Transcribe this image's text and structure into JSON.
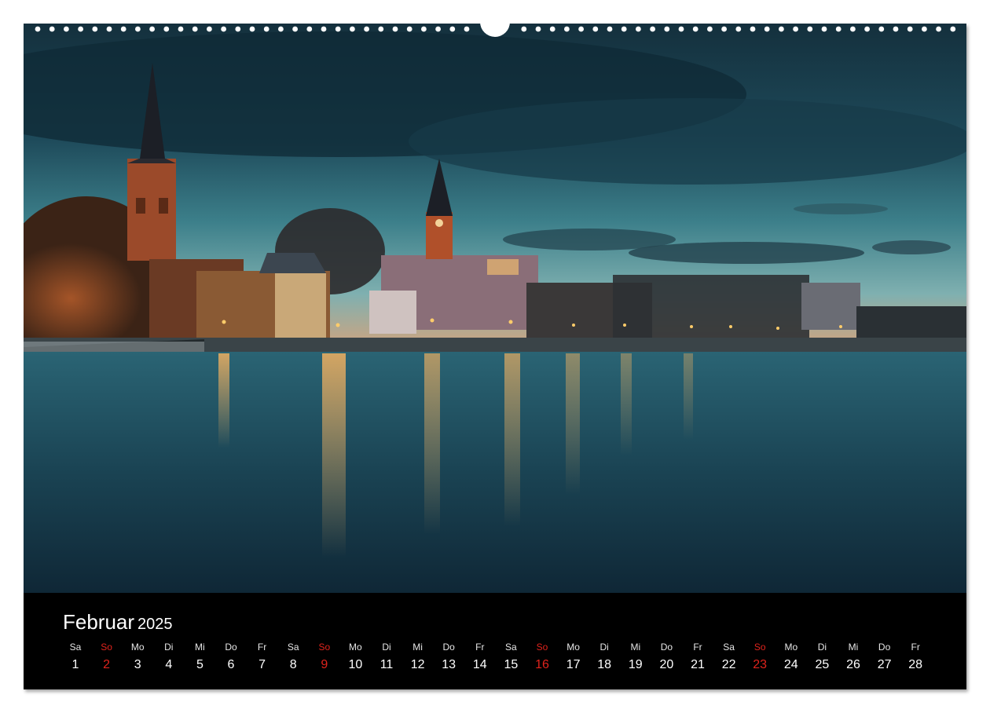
{
  "calendar": {
    "month": "Februar",
    "year": "2025",
    "days": [
      {
        "dow": "Sa",
        "num": "1",
        "sunday": false
      },
      {
        "dow": "So",
        "num": "2",
        "sunday": true
      },
      {
        "dow": "Mo",
        "num": "3",
        "sunday": false
      },
      {
        "dow": "Di",
        "num": "4",
        "sunday": false
      },
      {
        "dow": "Mi",
        "num": "5",
        "sunday": false
      },
      {
        "dow": "Do",
        "num": "6",
        "sunday": false
      },
      {
        "dow": "Fr",
        "num": "7",
        "sunday": false
      },
      {
        "dow": "Sa",
        "num": "8",
        "sunday": false
      },
      {
        "dow": "So",
        "num": "9",
        "sunday": true
      },
      {
        "dow": "Mo",
        "num": "10",
        "sunday": false
      },
      {
        "dow": "Di",
        "num": "11",
        "sunday": false
      },
      {
        "dow": "Mi",
        "num": "12",
        "sunday": false
      },
      {
        "dow": "Do",
        "num": "13",
        "sunday": false
      },
      {
        "dow": "Fr",
        "num": "14",
        "sunday": false
      },
      {
        "dow": "Sa",
        "num": "15",
        "sunday": false
      },
      {
        "dow": "So",
        "num": "16",
        "sunday": true
      },
      {
        "dow": "Mo",
        "num": "17",
        "sunday": false
      },
      {
        "dow": "Di",
        "num": "18",
        "sunday": false
      },
      {
        "dow": "Mi",
        "num": "19",
        "sunday": false
      },
      {
        "dow": "Do",
        "num": "20",
        "sunday": false
      },
      {
        "dow": "Fr",
        "num": "21",
        "sunday": false
      },
      {
        "dow": "Sa",
        "num": "22",
        "sunday": false
      },
      {
        "dow": "So",
        "num": "23",
        "sunday": true
      },
      {
        "dow": "Mo",
        "num": "24",
        "sunday": false
      },
      {
        "dow": "Di",
        "num": "25",
        "sunday": false
      },
      {
        "dow": "Mi",
        "num": "26",
        "sunday": false
      },
      {
        "dow": "Do",
        "num": "27",
        "sunday": false
      },
      {
        "dow": "Fr",
        "num": "28",
        "sunday": false
      }
    ]
  },
  "colors": {
    "sunday": "#e0231c",
    "weekday": "#ffffff",
    "bar_background": "#000000"
  },
  "icons": {
    "binding": "wire-binding-icon"
  }
}
